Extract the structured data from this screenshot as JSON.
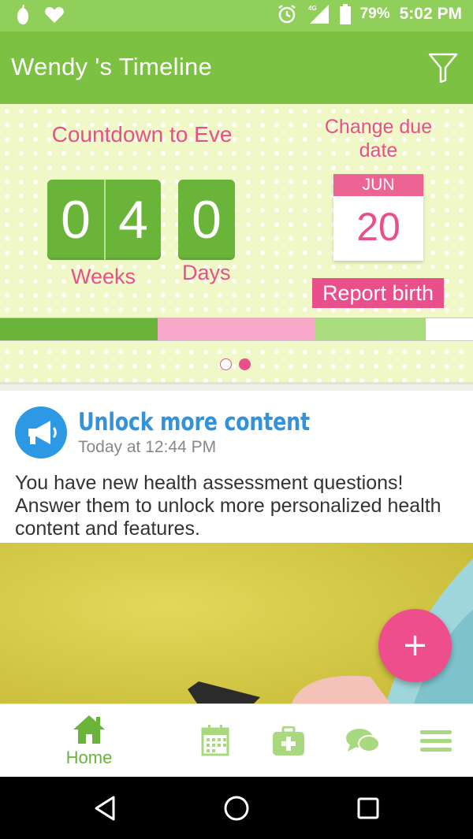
{
  "status_bar": {
    "battery_percent": "79%",
    "time": "5:02 PM",
    "network": "4G",
    "icons": [
      "pear-notification-icon",
      "heart-notification-icon",
      "alarm-icon",
      "signal-icon",
      "battery-icon"
    ]
  },
  "app_bar": {
    "title": "Wendy 's Timeline",
    "filter_icon": "filter-icon"
  },
  "countdown": {
    "title": "Countdown to Eve",
    "weeks_digits": [
      "0",
      "4"
    ],
    "days_digits": [
      "0"
    ],
    "weeks_label": "Weeks",
    "days_label": "Days",
    "change_due_label": "Change due date",
    "due_month": "JUN",
    "due_day": "20",
    "report_birth_label": "Report birth",
    "progress_segments": [
      {
        "color": "#6ab43a",
        "fraction": 0.333
      },
      {
        "color": "#f8a9c9",
        "fraction": 0.333
      },
      {
        "color": "#a8dc7c",
        "fraction": 0.234
      },
      {
        "color": "#ffffff",
        "fraction": 0.1
      }
    ],
    "pager": {
      "total": 2,
      "active": 2
    }
  },
  "feed_card": {
    "icon": "megaphone-icon",
    "title": "Unlock more content",
    "timestamp": "Today at 12:44 PM",
    "body": "You have new health assessment questions! Answer them to unlock more personalized health content and features."
  },
  "fab": {
    "label": "+"
  },
  "bottom_nav": {
    "items": [
      {
        "icon": "home-icon",
        "label": "Home",
        "active": true
      },
      {
        "icon": "calendar-icon",
        "label": "",
        "active": false
      },
      {
        "icon": "medical-kit-icon",
        "label": "",
        "active": false
      },
      {
        "icon": "chat-icon",
        "label": "",
        "active": false
      },
      {
        "icon": "menu-icon",
        "label": "",
        "active": false
      }
    ]
  },
  "colors": {
    "primary_green": "#7dc142",
    "status_bar_green": "#8fcf5a",
    "accent_pink": "#e94f8a",
    "link_blue": "#3392d9"
  }
}
